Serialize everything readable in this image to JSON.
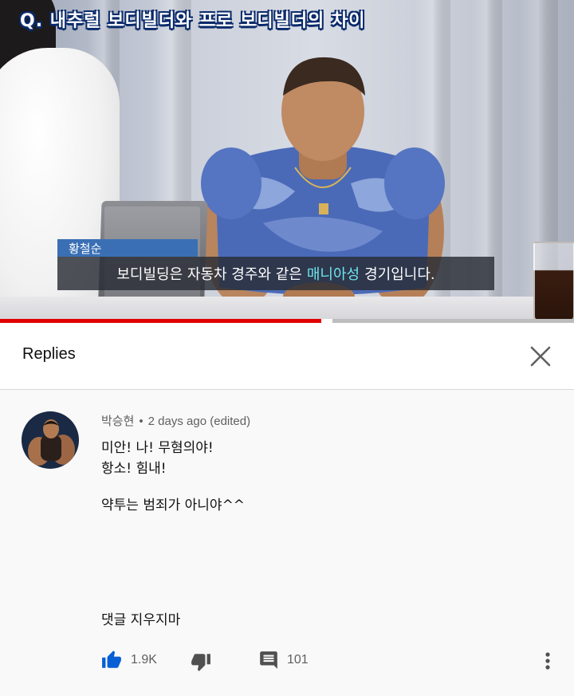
{
  "video": {
    "title_overlay": "Q. 내추럴 보디빌더와 프로 보디빌더의 차이",
    "speaker_name": "황철순",
    "subtitle_before": "보디빌딩은 자동차 경주와 같은",
    "subtitle_highlight": "매니아성",
    "subtitle_after": "경기입니다.",
    "progress_fraction": 0.56,
    "buffer_fraction": 0.58,
    "colors": {
      "progress": "#e00000",
      "subtitle_highlight": "#6ee6ef",
      "name_tag": "#3a6fb4"
    }
  },
  "panel": {
    "title": "Replies",
    "close_icon": "close-icon"
  },
  "comment": {
    "author": "박승현",
    "separator": "•",
    "time": "2 days ago (edited)",
    "lines": [
      "미안! 나! 무혐의야!",
      "항소! 힘내!",
      "약투는 범죄가 아니야^^",
      "댓글 지우지마"
    ],
    "likes": "1.9K",
    "replies": "101",
    "icons": {
      "like": "thumbs-up-icon",
      "dislike": "thumbs-down-icon",
      "reply": "comment-icon",
      "more": "more-vert-icon"
    },
    "colors": {
      "like_active": "#065fd4"
    }
  }
}
